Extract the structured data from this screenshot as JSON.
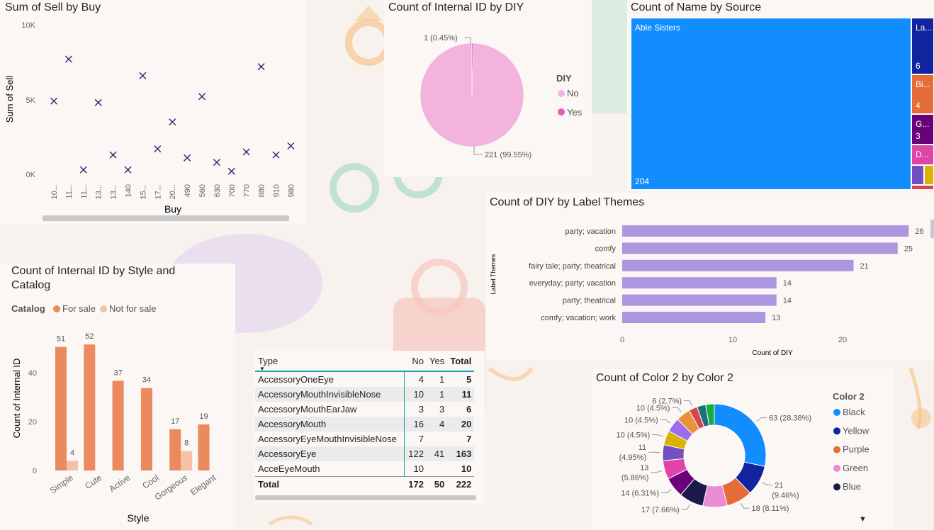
{
  "scatter": {
    "title": "Sum of Sell by Buy",
    "xlabel": "Buy",
    "ylabel": "Sum of Sell",
    "yticks": [
      "10K",
      "5K",
      "0K"
    ]
  },
  "pie": {
    "title": "Count of Internal ID by DIY",
    "legend_title": "DIY",
    "label_yes": "1 (0.45%)",
    "label_no": "221 (99.55%)"
  },
  "treemap": {
    "title": "Count of Name by Source"
  },
  "hbar": {
    "title": "Count of DIY by Label Themes",
    "xlabel": "Count of DIY",
    "ylabel": "Label Themes",
    "xticks": [
      "0",
      "10",
      "20"
    ]
  },
  "cbar": {
    "title_line1": "Count of Internal ID by Style and",
    "title_line2": "Catalog",
    "legend_title": "Catalog",
    "xlabel": "Style",
    "ylabel": "Count of Internal ID",
    "yticks": [
      "40",
      "20",
      "0"
    ]
  },
  "matrix": {
    "headers": [
      "Type",
      "No",
      "Yes",
      "Total"
    ],
    "rows": [
      [
        "AccessoryOneEye",
        "4",
        "1",
        "5"
      ],
      [
        "AccessoryMouthInvisibleNose",
        "10",
        "1",
        "11"
      ],
      [
        "AccessoryMouthEarJaw",
        "3",
        "3",
        "6"
      ],
      [
        "AccessoryMouth",
        "16",
        "4",
        "20"
      ],
      [
        "AccessoryEyeMouthInvisibleNose",
        "7",
        "",
        "7"
      ],
      [
        "AccessoryEye",
        "122",
        "41",
        "163"
      ],
      [
        "AcceEyeMouth",
        "10",
        "",
        "10"
      ]
    ],
    "total": [
      "Total",
      "172",
      "50",
      "222"
    ]
  },
  "donut": {
    "title": "Count of Color 2 by Color 2",
    "legend_title": "Color 2"
  },
  "chart_data": [
    {
      "type": "scatter",
      "title": "Sum of Sell by Buy",
      "xlabel": "Buy",
      "ylabel": "Sum of Sell",
      "ylim": [
        0,
        10000
      ],
      "categories": [
        "10...",
        "11...",
        "11...",
        "13...",
        "13...",
        "140",
        "15...",
        "17...",
        "20...",
        "490",
        "560",
        "630",
        "700",
        "770",
        "880",
        "910",
        "980"
      ],
      "values": [
        4900,
        7700,
        300,
        4800,
        1300,
        300,
        6600,
        1700,
        3500,
        1100,
        5200,
        800,
        200,
        1500,
        7200,
        1300,
        1900
      ],
      "marker": "x",
      "color": "#4b1572"
    },
    {
      "type": "pie",
      "title": "Count of Internal ID by DIY",
      "legend_title": "DIY",
      "slices": [
        {
          "name": "No",
          "value": 221,
          "label": "221 (99.55%)",
          "color": "#f2b3dd"
        },
        {
          "name": "Yes",
          "value": 1,
          "label": "1 (0.45%)",
          "color": "#e05fb9"
        }
      ]
    },
    {
      "type": "treemap",
      "title": "Count of Name by Source",
      "items": [
        {
          "name": "Able Sisters",
          "short": "Able Sisters",
          "value": 204,
          "color": "#118dff"
        },
        {
          "name": "La...",
          "short": "La...",
          "value": 6,
          "color": "#12239e"
        },
        {
          "name": "Bi...",
          "short": "Bi...",
          "value": 4,
          "color": "#e66c37"
        },
        {
          "name": "G...",
          "short": "G...",
          "value": 3,
          "color": "#6b007b"
        },
        {
          "name": "D...",
          "short": "D...",
          "value": 2,
          "color": "#e044a7"
        },
        {
          "name": "",
          "short": "",
          "value": 1,
          "color": "#744ec2"
        },
        {
          "name": "",
          "short": "",
          "value": 1,
          "color": "#d9b300"
        },
        {
          "name": "",
          "short": "",
          "value": 1,
          "color": "#d64550"
        }
      ]
    },
    {
      "type": "bar",
      "orientation": "horizontal",
      "title": "Count of DIY by Label Themes",
      "xlabel": "Count of DIY",
      "ylabel": "Label Themes",
      "xlim": [
        0,
        27
      ],
      "categories": [
        "party; vacation",
        "comfy",
        "fairy tale; party; theatrical",
        "everyday; party; vacation",
        "party; theatrical",
        "comfy; vacation; work"
      ],
      "values": [
        26,
        25,
        21,
        14,
        14,
        13
      ],
      "color": "#ad96e0"
    },
    {
      "type": "bar",
      "title": "Count of Internal ID by Style and Catalog",
      "xlabel": "Style",
      "ylabel": "Count of Internal ID",
      "ylim": [
        0,
        55
      ],
      "legend_title": "Catalog",
      "legend": "top-left",
      "categories": [
        "Simple",
        "Cute",
        "Active",
        "Cool",
        "Gorgeous",
        "Elegant"
      ],
      "series": [
        {
          "name": "For sale",
          "values": [
            51,
            52,
            37,
            34,
            17,
            19
          ],
          "color": "#ea8a5e"
        },
        {
          "name": "Not for sale",
          "values": [
            4,
            null,
            null,
            null,
            8,
            null
          ],
          "color": "#f7c1a8"
        }
      ]
    },
    {
      "type": "table",
      "columns": [
        "Type",
        "No",
        "Yes",
        "Total"
      ],
      "rows": [
        [
          "AccessoryOneEye",
          4,
          1,
          5
        ],
        [
          "AccessoryMouthInvisibleNose",
          10,
          1,
          11
        ],
        [
          "AccessoryMouthEarJaw",
          3,
          3,
          6
        ],
        [
          "AccessoryMouth",
          16,
          4,
          20
        ],
        [
          "AccessoryEyeMouthInvisibleNose",
          7,
          null,
          7
        ],
        [
          "AccessoryEye",
          122,
          41,
          163
        ],
        [
          "AcceEyeMouth",
          10,
          null,
          10
        ],
        [
          "Total",
          172,
          50,
          222
        ]
      ]
    },
    {
      "type": "pie",
      "donut": true,
      "title": "Count of Color 2 by Color 2",
      "legend_title": "Color 2",
      "legend_items": [
        "Black",
        "Yellow",
        "Purple",
        "Green",
        "Blue"
      ],
      "slices": [
        {
          "name": "Black",
          "value": 63,
          "label": "63 (28.38%)",
          "color": "#118dff"
        },
        {
          "name": "Yellow",
          "value": 21,
          "label": "21 (9.46%)",
          "color": "#12239e"
        },
        {
          "name": "Purple",
          "value": 18,
          "label": "18 (8.11%)",
          "color": "#e66c37"
        },
        {
          "name": "Green",
          "value": 17,
          "label": "",
          "color": "#e98bd5"
        },
        {
          "name": "Blue",
          "value": 17,
          "label": "17 (7.66%)",
          "color": "#1b1a4a"
        },
        {
          "name": "",
          "value": 14,
          "label": "14 (6.31%)",
          "color": "#6b007b"
        },
        {
          "name": "",
          "value": 13,
          "label": "13 (5.86%)",
          "color": "#e044a7"
        },
        {
          "name": "",
          "value": 11,
          "label": "11 (4.95%)",
          "color": "#744ec2"
        },
        {
          "name": "",
          "value": 10,
          "label": "10 (4.5%)",
          "color": "#d9b300"
        },
        {
          "name": "",
          "value": 10,
          "label": "10 (4.5%)",
          "color": "#9b6cf0"
        },
        {
          "name": "",
          "value": 10,
          "label": "10 (4.5%)",
          "color": "#e8923a"
        },
        {
          "name": "",
          "value": 6,
          "label": "6 (2.7%)",
          "color": "#d64550"
        },
        {
          "name": "",
          "value": 6,
          "label": "",
          "color": "#197278"
        },
        {
          "name": "",
          "value": 6,
          "label": "",
          "color": "#1aab40"
        }
      ]
    }
  ]
}
